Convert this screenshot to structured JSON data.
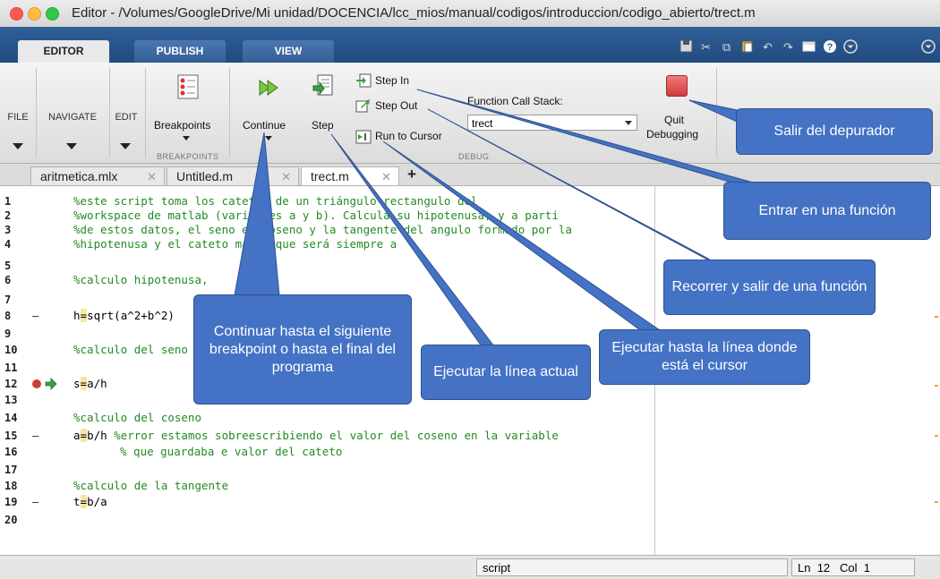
{
  "window": {
    "title": "Editor - /Volumes/GoogleDrive/Mi unidad/DOCENCIA/lcc_mios/manual/codigos/introduccion/codigo_abierto/trect.m"
  },
  "toolstrip": {
    "tabs": [
      "EDITOR",
      "PUBLISH",
      "VIEW"
    ],
    "active_tab": "EDITOR"
  },
  "ribbon": {
    "file": "FILE",
    "navigate": "NAVIGATE",
    "edit": "EDIT",
    "breakpoints": "Breakpoints",
    "breakpoints_group": "BREAKPOINTS",
    "continue": "Continue",
    "step": "Step",
    "step_in": "Step In",
    "step_out": "Step Out",
    "run_to_cursor": "Run to Cursor",
    "function_call_stack_label": "Function Call Stack:",
    "function_call_stack_value": "trect",
    "quit_line1": "Quit",
    "quit_line2": "Debugging",
    "debug_group": "DEBUG"
  },
  "editor_tabs": [
    {
      "label": "aritmetica.mlx",
      "active": false
    },
    {
      "label": "Untitled.m",
      "active": false
    },
    {
      "label": "trect.m",
      "active": true
    }
  ],
  "code": {
    "line_numbers": [
      "1",
      "2",
      "3",
      "4",
      "5",
      "6",
      "7",
      "8",
      "9",
      "10",
      "11",
      "12",
      "13",
      "14",
      "15",
      "16",
      "17",
      "18",
      "19",
      "20"
    ],
    "line1": "%este script toma los catetos de un triángulo rectangulo del",
    "line2": "%workspace de matlab (variables a y b). Calcula su hipotenusa, y a parti",
    "line3": "%de estos datos, el seno el coseno y la tangente del angulo formado por la",
    "line4": "%hipotenusa y el cateto mayor que será siempre a",
    "line6": "%calculo hipotenusa,",
    "line8a": "h",
    "line8b": "=",
    "line8c": "sqrt(a^2+b^2)",
    "line10": "%calculo del seno",
    "line12a": "s",
    "line12b": "=",
    "line12c": "a/h",
    "line14": "%calculo del coseno",
    "line15a": "a",
    "line15b": "=",
    "line15c": "b/h ",
    "line15d": "%error estamos sobreescribiendo el valor del coseno en la variable",
    "line16": "% que guardaba e valor del cateto",
    "line18": "%calculo de la tangente",
    "line19a": "t",
    "line19b": "=",
    "line19c": "b/a"
  },
  "status": {
    "mode": "script",
    "ln_label": "Ln",
    "ln_value": "12",
    "col_label": "Col",
    "col_value": "1"
  },
  "callouts": {
    "quit": "Salir del depurador",
    "step_in": "Entrar en una función",
    "step_out": "Recorrer y salir de una función",
    "run_to_cursor": "Ejecutar hasta la línea donde está el cursor",
    "step": "Ejecutar la línea actual",
    "continue": "Continuar hasta el siguiente breakpoint o hasta el final del programa"
  },
  "colors": {
    "toolstrip_blue": "#2f5f98",
    "callout_blue": "#4472c4",
    "comment_green": "#228b22",
    "breakpoint_red": "#d13a3a"
  }
}
